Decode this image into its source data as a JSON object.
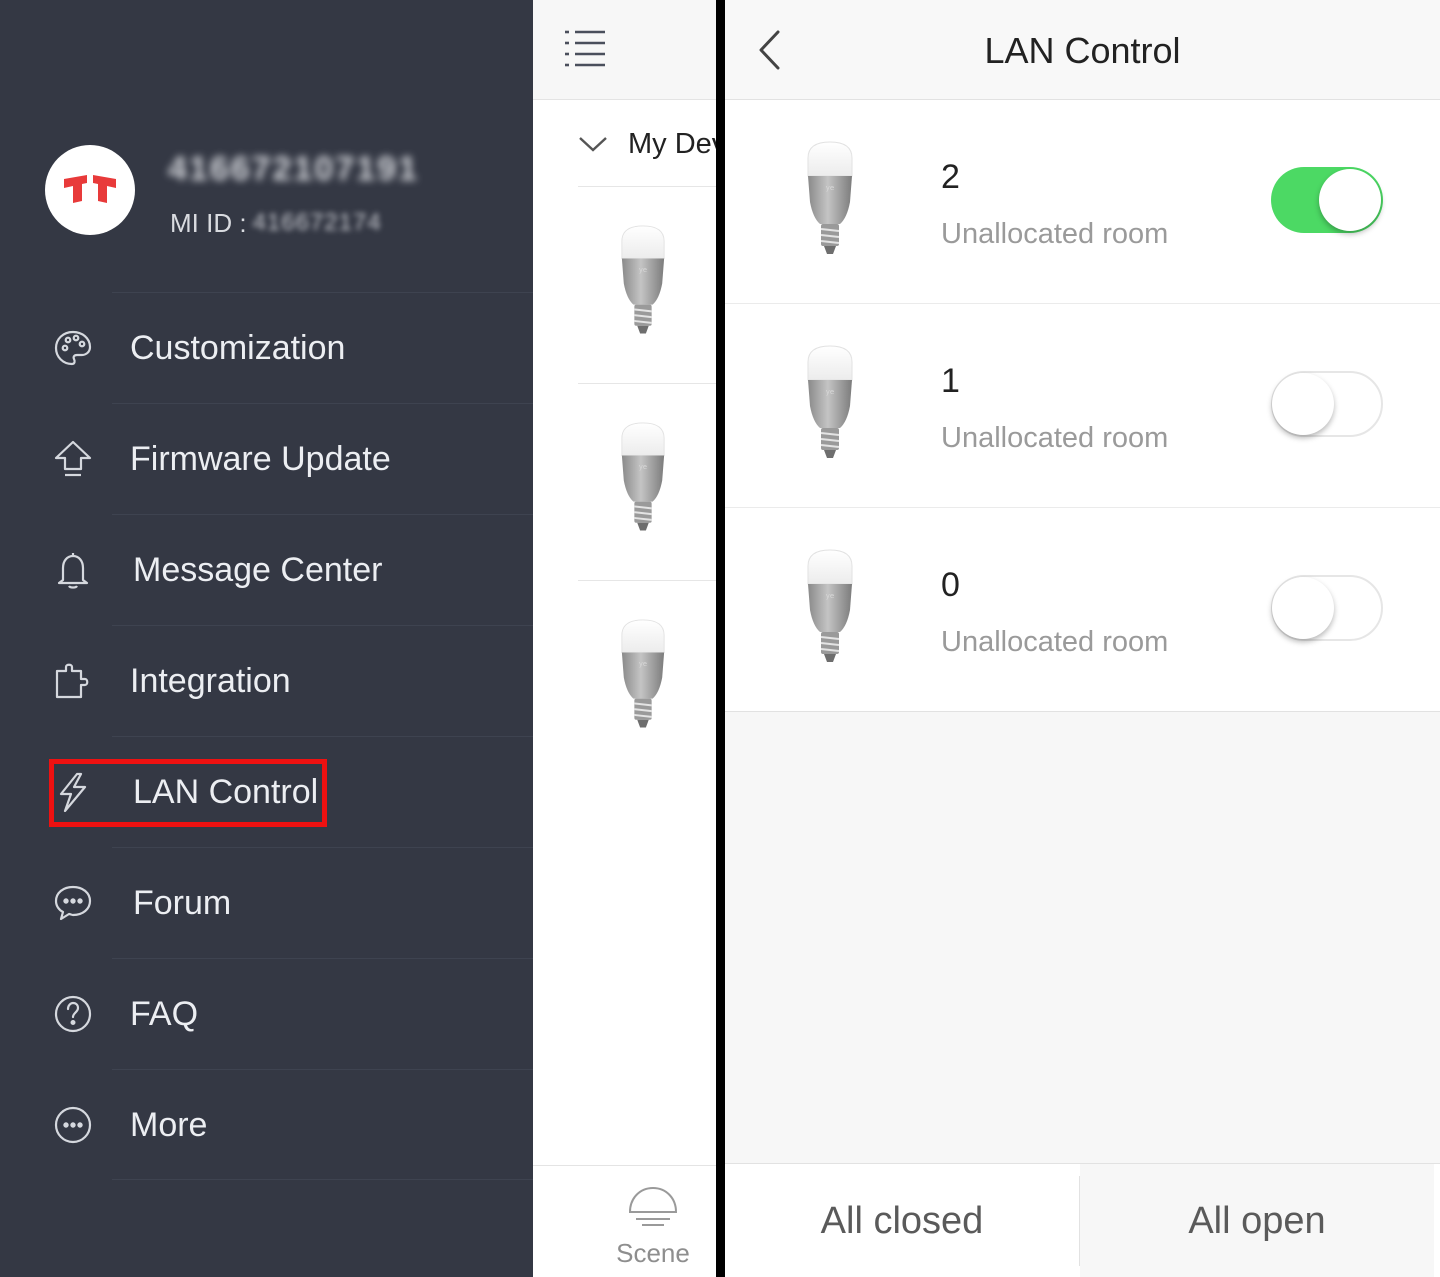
{
  "drawer": {
    "user_name": "416672107191",
    "mi_id_label": "MI ID :",
    "mi_id_value": "416672174",
    "menu": [
      {
        "label": "Customization",
        "icon": "palette-icon"
      },
      {
        "label": "Firmware Update",
        "icon": "upload-arrow-icon"
      },
      {
        "label": "Message Center",
        "icon": "bell-icon"
      },
      {
        "label": "Integration",
        "icon": "puzzle-icon"
      },
      {
        "label": "LAN Control",
        "icon": "lightning-icon"
      },
      {
        "label": "Forum",
        "icon": "chat-bubble-icon"
      },
      {
        "label": "FAQ",
        "icon": "question-circle-icon"
      },
      {
        "label": "More",
        "icon": "more-circle-icon"
      }
    ],
    "highlighted_item": "LAN Control"
  },
  "middle": {
    "section_label": "My Dev",
    "bottom_tab_label": "Scene"
  },
  "lan_control": {
    "title": "LAN Control",
    "devices": [
      {
        "name": "2",
        "room": "Unallocated room",
        "enabled": true
      },
      {
        "name": "1",
        "room": "Unallocated room",
        "enabled": false
      },
      {
        "name": "0",
        "room": "Unallocated room",
        "enabled": false
      }
    ],
    "all_closed_label": "All closed",
    "all_open_label": "All open"
  },
  "colors": {
    "drawer_bg": "#343844",
    "toggle_on": "#4cd964",
    "highlight_border": "#ee1111",
    "brand_red": "#e83a3a"
  }
}
